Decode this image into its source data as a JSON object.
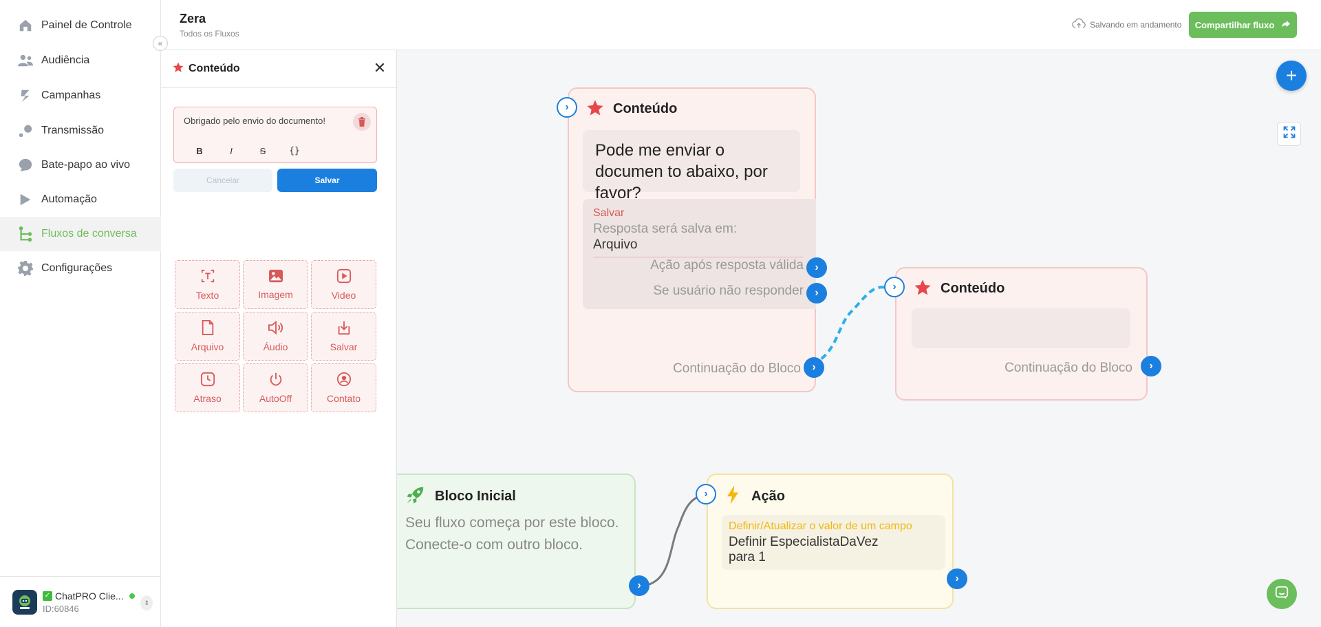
{
  "sidebar": {
    "items": [
      {
        "label": "Painel de Controle",
        "icon": "home-icon"
      },
      {
        "label": "Audiência",
        "icon": "users-icon"
      },
      {
        "label": "Campanhas",
        "icon": "campaign-icon"
      },
      {
        "label": "Transmissão",
        "icon": "broadcast-icon"
      },
      {
        "label": "Bate-papo ao vivo",
        "icon": "chat-icon"
      },
      {
        "label": "Automação",
        "icon": "play-icon"
      },
      {
        "label": "Fluxos de conversa",
        "icon": "flow-icon",
        "active": true
      },
      {
        "label": "Configurações",
        "icon": "gear-icon"
      }
    ],
    "account": {
      "name": "ChatPRO Clie...",
      "id": "ID:60846"
    }
  },
  "header": {
    "title": "Zera",
    "subtitle": "Todos os Fluxos",
    "saving_text": "Salvando em andamento",
    "share_label": "Compartilhar fluxo"
  },
  "panel": {
    "title": "Conteúdo",
    "editor_text": "Obrigado pelo envio do documento!",
    "format_buttons": [
      "B",
      "I",
      "S",
      "{}"
    ],
    "cancel_label": "Cancelar",
    "save_label": "Salvar",
    "tools": [
      "Texto",
      "Imagem",
      "Video",
      "Arquivo",
      "Áudio",
      "Salvar",
      "Atraso",
      "AutoOff",
      "Contato"
    ]
  },
  "canvas": {
    "node_content_1": {
      "title": "Conteúdo",
      "message": "Pode me enviar o documen to abaixo, por favor?",
      "save_heading": "Salvar",
      "save_desc": "Resposta será salva em:",
      "save_value": "Arquivo",
      "after_valid": "Ação após resposta válida",
      "no_reply": "Se usuário não responder",
      "continuation": "Continuação do Bloco"
    },
    "node_content_2": {
      "title": "Conteúdo",
      "continuation": "Continuação do Bloco"
    },
    "node_start": {
      "title": "Bloco Inicial",
      "desc": "Seu fluxo começa por este bloco. Conecte-o com outro bloco."
    },
    "node_action": {
      "title": "Ação",
      "action_heading": "Definir/Atualizar o valor de um campo",
      "action_line1": "Definir EspecialistaDaVez",
      "action_line2": "para 1"
    }
  },
  "colors": {
    "brand_green": "#6cbd5c",
    "primary_blue": "#1b7fe0",
    "content_red": "#e8474a",
    "action_yellow": "#f2b80e"
  }
}
